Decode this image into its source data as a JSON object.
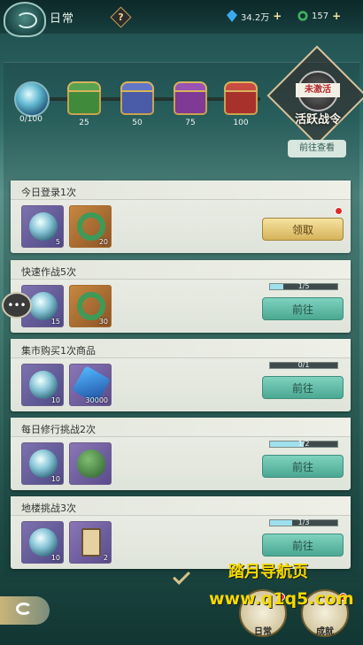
{
  "header": {
    "title": "日常",
    "help_label": "?",
    "currency1": "34.2万",
    "currency2": "157",
    "plus": "+"
  },
  "activity": {
    "current": "0/100",
    "milestones": [
      {
        "value": "25"
      },
      {
        "value": "50"
      },
      {
        "value": "75"
      },
      {
        "value": "100"
      }
    ],
    "pass_status": "未激活",
    "pass_title": "活跃战令",
    "pass_button": "前往查看"
  },
  "tasks": [
    {
      "name": "今日登录1次",
      "rewards": [
        {
          "icon": "orb-icon",
          "qty": "5"
        },
        {
          "icon": "jade-ring-icon",
          "qty": "20"
        }
      ],
      "progress": "",
      "button": "领取",
      "state": "claim"
    },
    {
      "name": "快速作战5次",
      "rewards": [
        {
          "icon": "orb-icon",
          "qty": "15"
        },
        {
          "icon": "jade-ring-icon",
          "qty": "30"
        }
      ],
      "progress": "1/5",
      "progress_frac": 0.2,
      "button": "前往",
      "state": "go"
    },
    {
      "name": "集市购买1次商品",
      "rewards": [
        {
          "icon": "orb-icon",
          "qty": "10"
        },
        {
          "icon": "crystal-icon",
          "qty": "30000"
        }
      ],
      "progress": "0/1",
      "progress_frac": 0,
      "button": "前往",
      "state": "go"
    },
    {
      "name": "每日修行挑战2次",
      "rewards": [
        {
          "icon": "orb-icon",
          "qty": "10"
        },
        {
          "icon": "egg-icon",
          "qty": ""
        }
      ],
      "progress": "1/2",
      "progress_frac": 0.5,
      "button": "前往",
      "state": "go"
    },
    {
      "name": "地楼挑战3次",
      "rewards": [
        {
          "icon": "orb-icon",
          "qty": "10"
        },
        {
          "icon": "banner-icon",
          "qty": "2"
        }
      ],
      "progress": "1/3",
      "progress_frac": 0.33,
      "button": "前往",
      "state": "go"
    }
  ],
  "bottom": {
    "tab_daily": "日常",
    "tab_achieve": "成就"
  },
  "watermark": {
    "line1": "踏月导航页",
    "line2": "www.q1q5.com"
  },
  "colors": {
    "go_button": "#4ba892",
    "claim_button": "#d6b35b",
    "red_dot": "#e02a28"
  }
}
